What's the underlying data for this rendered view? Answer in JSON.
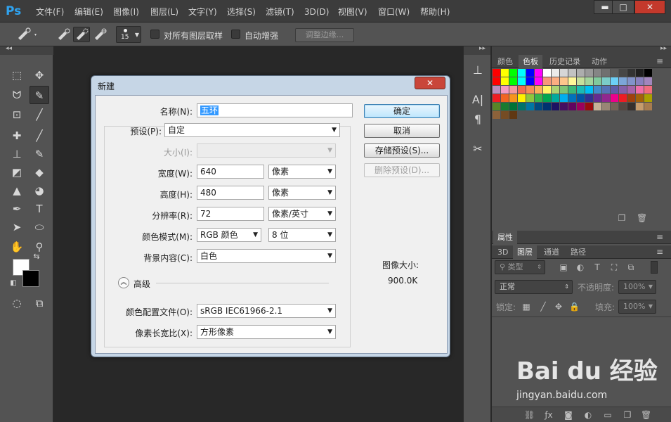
{
  "menubar": {
    "logo": "Ps",
    "items": [
      "文件(F)",
      "编辑(E)",
      "图像(I)",
      "图层(L)",
      "文字(Y)",
      "选择(S)",
      "滤镜(T)",
      "3D(D)",
      "视图(V)",
      "窗口(W)",
      "帮助(H)"
    ],
    "window_controls": {
      "minimize": "▬",
      "maximize": "□",
      "close": "✕"
    }
  },
  "options_bar": {
    "brush_size": "15",
    "sample_all_layers": "对所有图层取样",
    "auto_enhance": "自动增强",
    "refine_edge": "调整边缘..."
  },
  "right_panels": {
    "swatch_tabs": [
      "颜色",
      "色板",
      "历史记录",
      "动作"
    ],
    "swatch_active": "色板",
    "properties_tab": "属性",
    "layer_tabs": [
      "3D",
      "图层",
      "通道",
      "路径"
    ],
    "layer_active": "图层",
    "kind_filter": "类型",
    "blend_mode": "正常",
    "opacity_label": "不透明度:",
    "opacity_value": "100%",
    "lock_label": "锁定:",
    "fill_label": "填充:",
    "fill_value": "100%",
    "swatch_colors": [
      "#ff0000",
      "#ffff00",
      "#00ff00",
      "#00ffff",
      "#0000ff",
      "#ff00ff",
      "#ffffff",
      "#ebebeb",
      "#d6d6d6",
      "#c2c2c2",
      "#adadad",
      "#999999",
      "#858585",
      "#707070",
      "#5c5c5c",
      "#474747",
      "#333333",
      "#1f1f1f",
      "#000000",
      "#ff0000",
      "#ffff00",
      "#00ff00",
      "#00ffff",
      "#0000ff",
      "#ff00ff",
      "#f7977a",
      "#fbad82",
      "#fdc68c",
      "#fff799",
      "#c6df9c",
      "#a4d49d",
      "#81ca9d",
      "#7bcdc9",
      "#6ccff7",
      "#7ca6d8",
      "#8293ca",
      "#8881be",
      "#a286bd",
      "#bc8cbf",
      "#f49bc1",
      "#f5999d",
      "#f26c4f",
      "#f68e56",
      "#fbaf5a",
      "#fff468",
      "#acd372",
      "#7cc576",
      "#3bb878",
      "#1abbb4",
      "#00bff3",
      "#438ccb",
      "#5573b7",
      "#5e5ca7",
      "#855fa8",
      "#a763a9",
      "#ef6ea8",
      "#f16d7e",
      "#ee1d24",
      "#f16522",
      "#f7941d",
      "#fff100",
      "#8fc63d",
      "#37b44a",
      "#00a650",
      "#00a99e",
      "#00aeef",
      "#0072bc",
      "#0054a5",
      "#2f3192",
      "#652c91",
      "#91278f",
      "#ec008c",
      "#ed1c24",
      "#a0410d",
      "#a36209",
      "#aba000",
      "#588528",
      "#197b30",
      "#007236",
      "#00736a",
      "#0076a4",
      "#004a80",
      "#003370",
      "#1d1363",
      "#450e61",
      "#62055f",
      "#9e005d",
      "#9d0a0e",
      "#c7b299",
      "#998675",
      "#736357",
      "#534741",
      "#37302d",
      "#c69c6d",
      "#a77c50",
      "#8c623a",
      "#754c24",
      "#603813"
    ]
  },
  "dialog": {
    "title": "新建",
    "close": "✕",
    "name_label": "名称(N):",
    "name_value": "五环",
    "preset_label": "预设(P):",
    "preset_value": "自定",
    "size_label": "大小(I):",
    "width_label": "宽度(W):",
    "width_value": "640",
    "width_unit": "像素",
    "height_label": "高度(H):",
    "height_value": "480",
    "height_unit": "像素",
    "resolution_label": "分辨率(R):",
    "resolution_value": "72",
    "resolution_unit": "像素/英寸",
    "color_mode_label": "颜色模式(M):",
    "color_mode_value": "RGB 颜色",
    "bit_depth": "8 位",
    "bg_contents_label": "背景内容(C):",
    "bg_contents_value": "白色",
    "advanced_label": "高级",
    "color_profile_label": "颜色配置文件(O):",
    "color_profile_value": "sRGB IEC61966-2.1",
    "pixel_aspect_label": "像素长宽比(X):",
    "pixel_aspect_value": "方形像素",
    "ok_button": "确定",
    "cancel_button": "取消",
    "save_preset_button": "存储预设(S)...",
    "delete_preset_button": "删除预设(D)...",
    "image_size_label": "图像大小:",
    "image_size_value": "900.0K"
  },
  "watermark": {
    "logo": "Bai du 经验",
    "url": "jingyan.baidu.com"
  }
}
